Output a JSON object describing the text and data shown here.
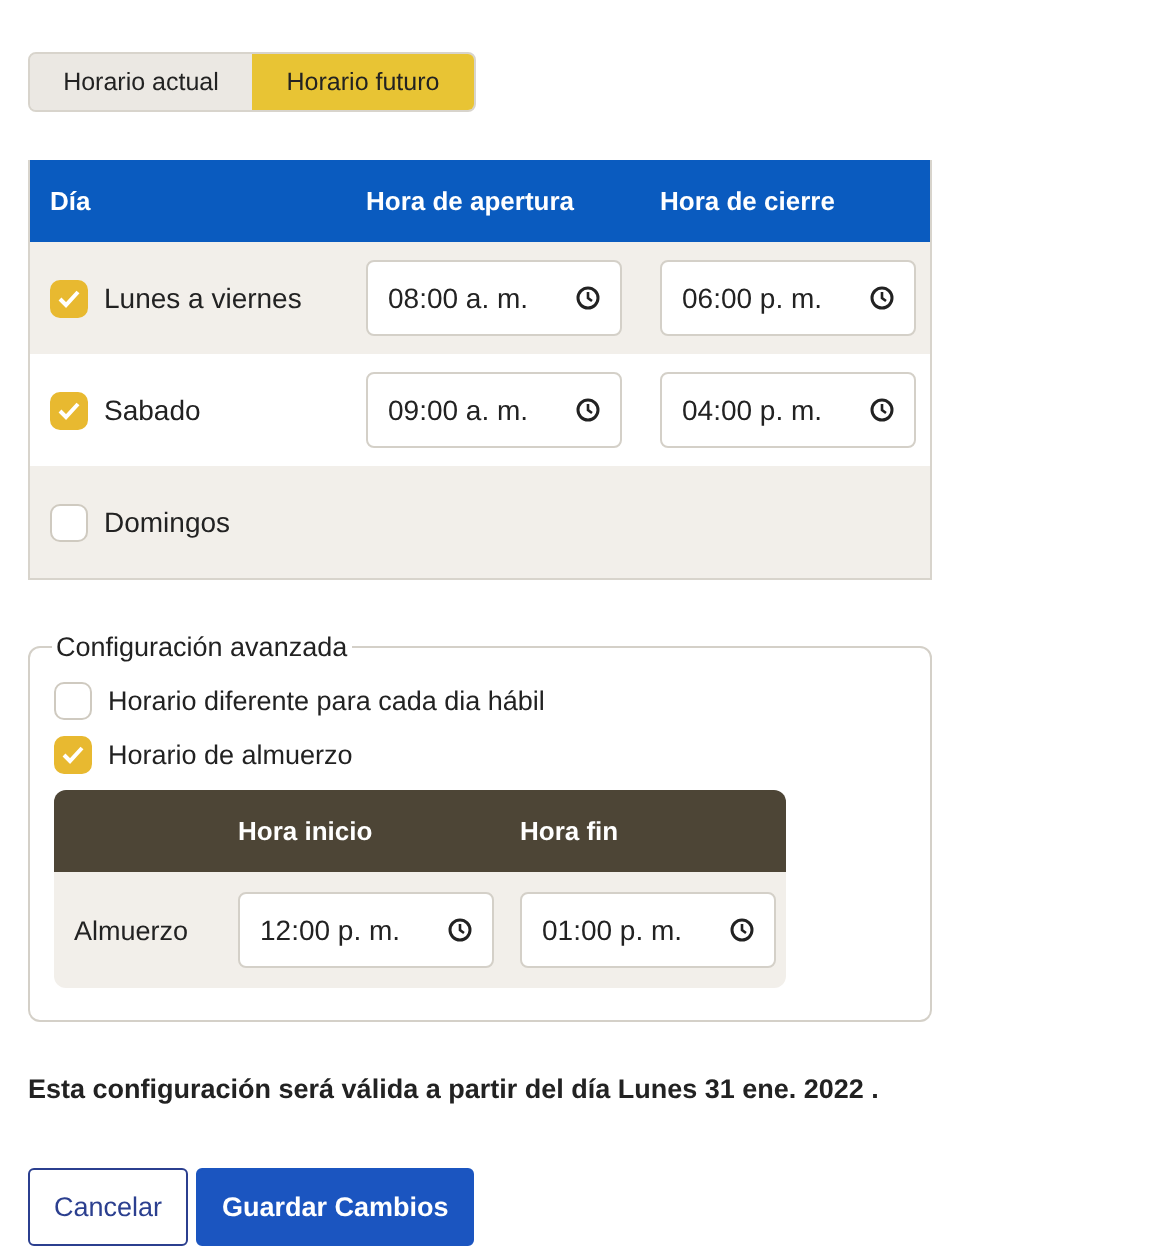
{
  "tabs": [
    {
      "label": "Horario actual",
      "selected": false
    },
    {
      "label": "Horario futuro",
      "selected": true
    }
  ],
  "schedule": {
    "columns": [
      "Día",
      "Hora de apertura",
      "Hora de cierre"
    ],
    "rows": [
      {
        "day": "Lunes a viernes",
        "checked": true,
        "open": "08:00 a. m.",
        "close": "06:00 p. m."
      },
      {
        "day": "Sabado",
        "checked": true,
        "open": "09:00 a. m.",
        "close": "04:00 p. m."
      },
      {
        "day": "Domingos",
        "checked": false
      }
    ]
  },
  "advanced": {
    "legend": "Configuración avanzada",
    "options": [
      {
        "label": "Horario diferente para cada dia hábil",
        "checked": false
      },
      {
        "label": "Horario de almuerzo",
        "checked": true
      }
    ],
    "lunch": {
      "columns": [
        "Hora inicio",
        "Hora fin"
      ],
      "rows": [
        {
          "label": "Almuerzo",
          "start": "12:00 p. m.",
          "end": "01:00 p. m."
        }
      ]
    }
  },
  "notice": "Esta configuración será válida a partir del día Lunes 31 ene. 2022 .",
  "buttons": [
    {
      "label": "Cancelar",
      "kind": "secondary"
    },
    {
      "label": "Guardar Cambios",
      "kind": "primary"
    }
  ]
}
